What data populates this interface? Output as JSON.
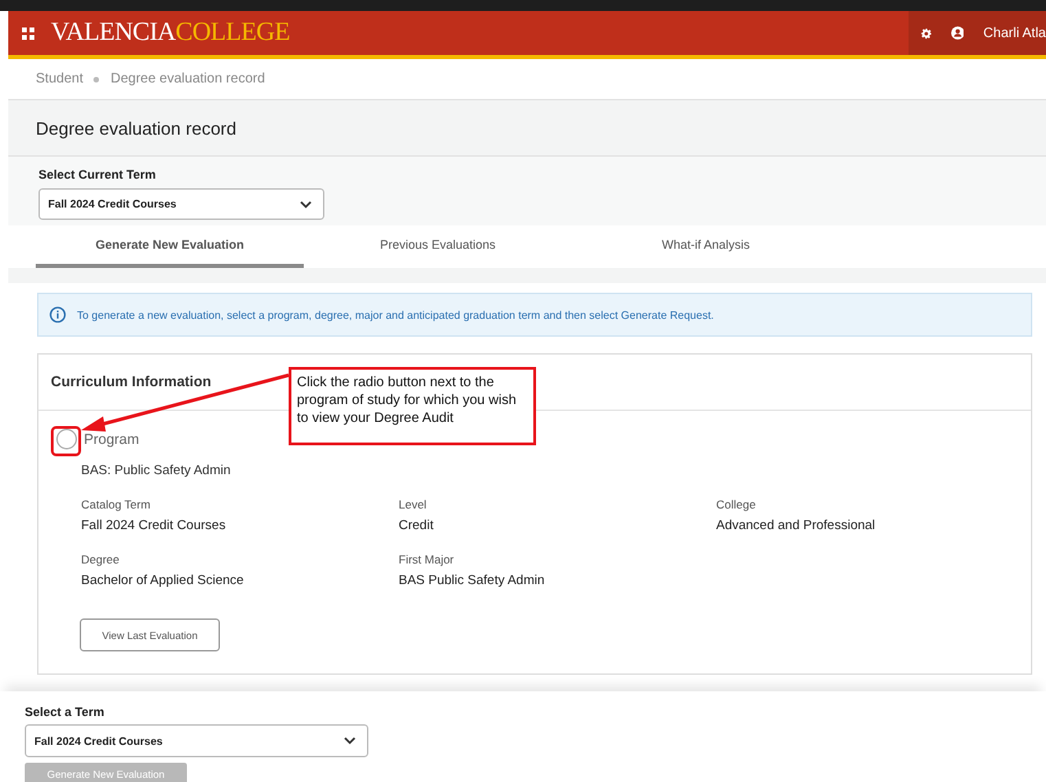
{
  "header": {
    "logo": [
      "VALENCIA",
      "COLLEGE"
    ],
    "user_name": "Charli Atla"
  },
  "breadcrumb": [
    "Student",
    "Degree evaluation record"
  ],
  "page_title": "Degree evaluation record",
  "current_term": {
    "label": "Select Current Term",
    "value": "Fall 2024 Credit Courses"
  },
  "tabs": [
    {
      "label": "Generate New Evaluation",
      "selected": true
    },
    {
      "label": "Previous Evaluations",
      "selected": false
    },
    {
      "label": "What-if Analysis",
      "selected": false
    }
  ],
  "info_message": "To generate a new evaluation, select a program, degree, major and anticipated graduation term and then select Generate Request.",
  "curriculum": {
    "title": "Curriculum Information",
    "program": {
      "label": "Program",
      "selected": false,
      "name": "BAS: Public Safety Admin"
    },
    "fields": [
      {
        "label": "Catalog Term",
        "value": "Fall 2024 Credit Courses"
      },
      {
        "label": "Level",
        "value": "Credit"
      },
      {
        "label": "College",
        "value": "Advanced and Professional"
      },
      {
        "label": "Degree",
        "value": "Bachelor of Applied Science"
      },
      {
        "label": "First Major",
        "value": "BAS Public Safety Admin"
      }
    ],
    "button": "View Last Evaluation"
  },
  "annotation": {
    "text": "Click the radio button next to the program of study for which you wish to view your Degree Audit"
  },
  "term_picker": {
    "label": "Select a Term",
    "value": "Fall 2024 Credit Courses",
    "button": {
      "label": "Generate New Evaluation",
      "disabled": true
    }
  }
}
